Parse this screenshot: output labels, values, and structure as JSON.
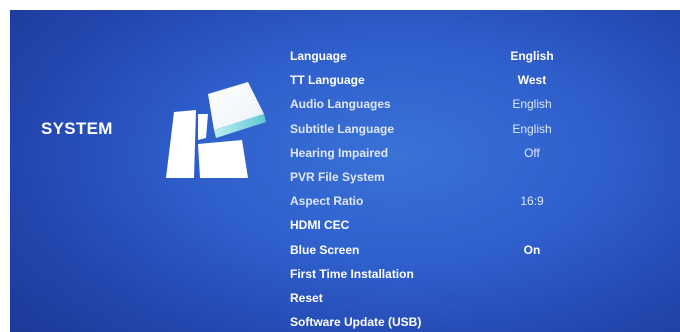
{
  "section": {
    "title": "SYSTEM",
    "icon": "system-tiles-icon"
  },
  "menu": {
    "items": [
      {
        "label": "Language",
        "value": "English"
      },
      {
        "label": "TT Language",
        "value": "West"
      },
      {
        "label": "Audio Languages",
        "value": "English"
      },
      {
        "label": "Subtitle Language",
        "value": "English"
      },
      {
        "label": "Hearing Impaired",
        "value": "Off"
      },
      {
        "label": "PVR File System",
        "value": ""
      },
      {
        "label": "Aspect Ratio",
        "value": "16:9"
      },
      {
        "label": "HDMI CEC",
        "value": ""
      },
      {
        "label": "Blue Screen",
        "value": "On"
      },
      {
        "label": "First Time Installation",
        "value": ""
      },
      {
        "label": "Reset",
        "value": ""
      },
      {
        "label": "Software Update (USB)",
        "value": ""
      }
    ]
  },
  "colors": {
    "background": "#2f5fcc",
    "text": "#ffffff",
    "accent": "#7fd6df"
  }
}
